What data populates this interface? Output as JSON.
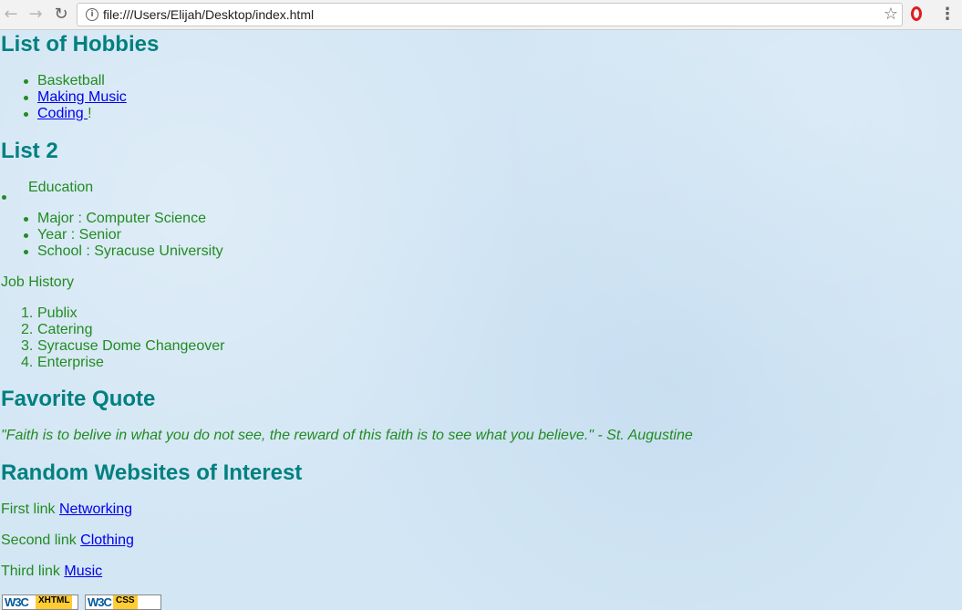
{
  "browser": {
    "url": "file:///Users/Elijah/Desktop/index.html",
    "icons": {
      "back": "arrow-left-icon",
      "forward": "arrow-right-icon",
      "reload": "reload-icon",
      "info": "info-icon",
      "bookmark": "star-icon",
      "opera": "opera-icon",
      "menu": "kebab-menu-icon"
    }
  },
  "hobbies": {
    "heading": "List of Hobbies",
    "items": [
      "Basketball",
      "Making Music",
      "Coding "
    ],
    "coding_suffix": "!"
  },
  "list2": {
    "heading": "List 2",
    "education_label": "Education",
    "education_items": [
      "Major : Computer Science",
      "Year : Senior",
      "School : Syracuse University"
    ],
    "job_label": "Job History",
    "jobs": [
      "Publix",
      "Catering",
      "Syracuse Dome Changeover",
      "Enterprise"
    ]
  },
  "quote": {
    "heading": "Favorite Quote",
    "text": "\"Faith is to belive in what you do not see, the reward of this faith is to see what you believe.\" - St. Augustine"
  },
  "websites": {
    "heading": "Random Websites of Interest",
    "links": [
      {
        "prefix": "First link ",
        "label": "Networking"
      },
      {
        "prefix": "Second link ",
        "label": "Clothing"
      },
      {
        "prefix": "Third link ",
        "label": "Music"
      }
    ]
  },
  "badges": [
    {
      "logo": "W3C",
      "label": "XHTML"
    },
    {
      "logo": "W3C",
      "label": "CSS"
    }
  ],
  "colors": {
    "heading": "#008080",
    "text": "#228b22",
    "link": "#0000ee",
    "background": "#d3e6f4"
  }
}
